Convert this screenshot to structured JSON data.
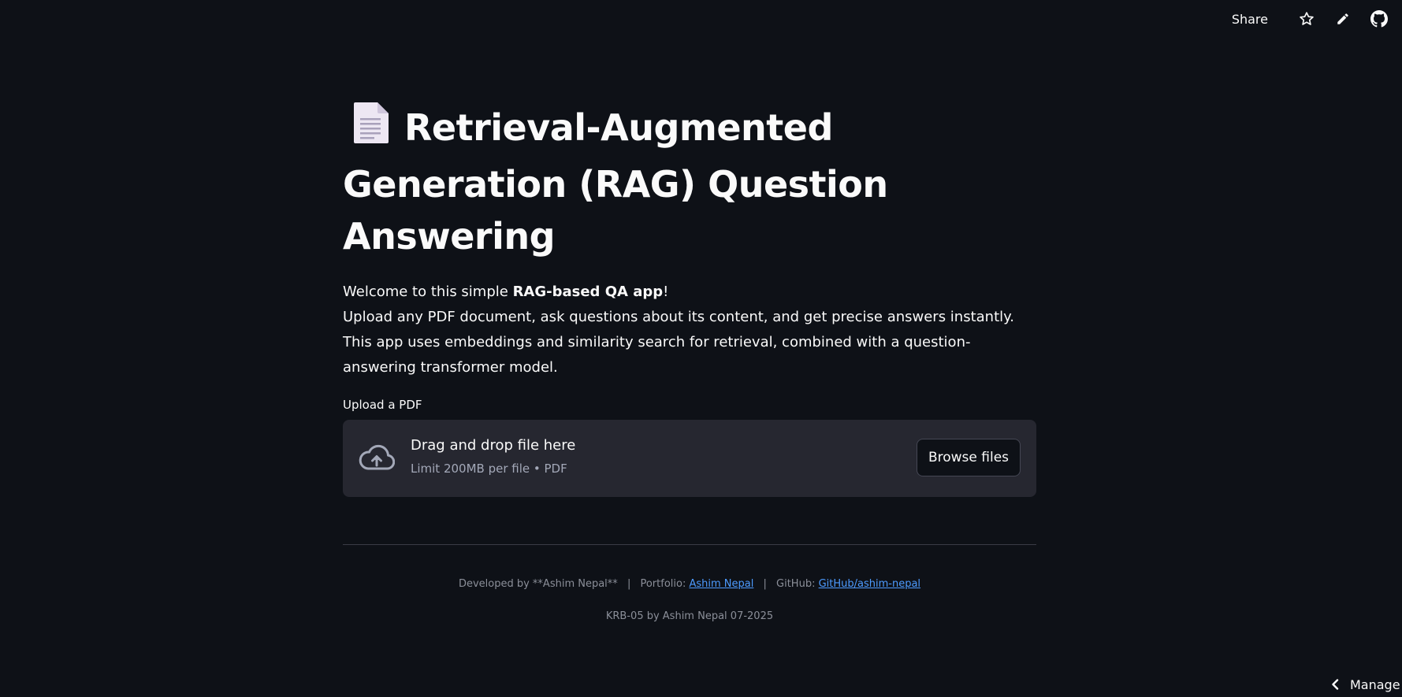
{
  "header": {
    "share_label": "Share",
    "icons": [
      "star-icon",
      "pencil-icon",
      "github-icon"
    ]
  },
  "main": {
    "title_icon": "page-facing-up-icon",
    "title": "Retrieval-Augmented Generation (RAG) Question Answering",
    "intro": {
      "line1_prefix": "Welcome to this simple ",
      "line1_bold": "RAG-based QA app",
      "line1_suffix": "!",
      "line2": "Upload any PDF document, ask questions about its content, and get precise answers instantly.",
      "line3": "This app uses embeddings and similarity search for retrieval, combined with a question-answering transformer model."
    },
    "uploader": {
      "label": "Upload a PDF",
      "drag_text": "Drag and drop file here",
      "limit_text": "Limit 200MB per file • PDF",
      "browse_label": "Browse files",
      "icon": "cloud-upload-icon"
    }
  },
  "footer": {
    "developed_by": "Developed by **Ashim Nepal**",
    "sep": "|",
    "portfolio_label": "Portfolio:",
    "portfolio_link": "Ashim Nepal",
    "github_label": "GitHub:",
    "github_link": "GitHub/ashim-nepal",
    "credit": "KRB-05 by Ashim Nepal 07-2025"
  },
  "manage": {
    "label": "Manage app"
  },
  "colors": {
    "background": "#0e1117",
    "dropzone": "#262730",
    "link": "#4d9bff",
    "text": "#fafafa",
    "muted": "#8b8f99"
  }
}
